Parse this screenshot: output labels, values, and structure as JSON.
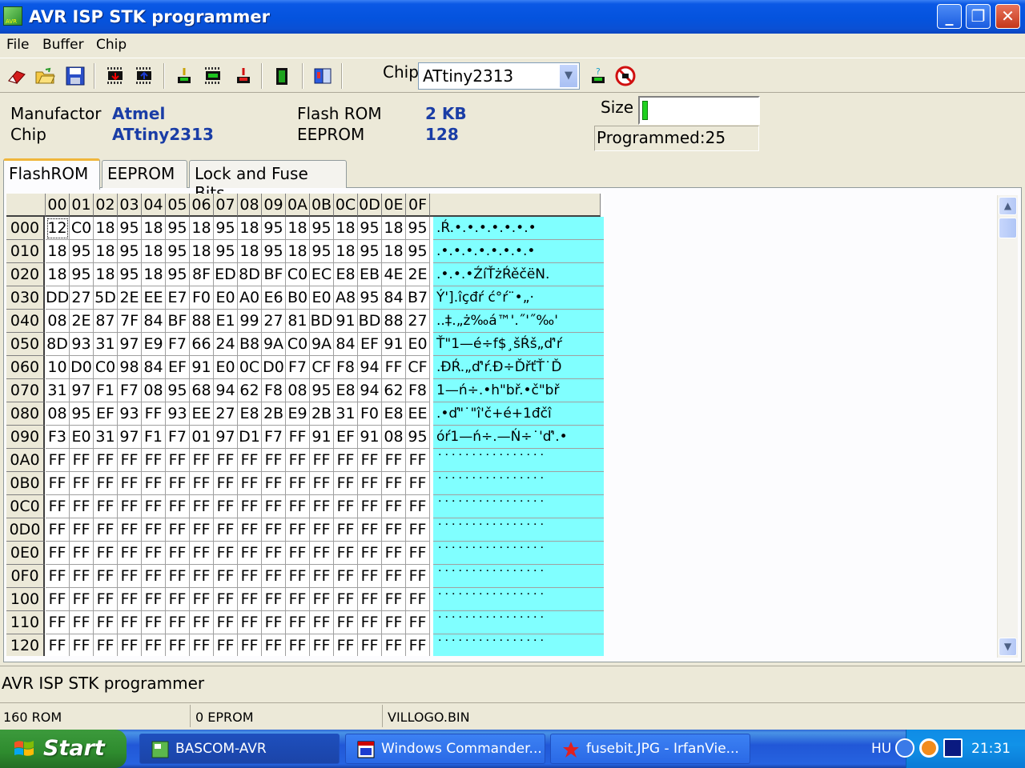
{
  "window": {
    "title": "AVR ISP STK programmer",
    "minimize_glyph": "_",
    "maximize_glyph": "❐",
    "close_glyph": "✕"
  },
  "menu": [
    "File",
    "Buffer",
    "Chip"
  ],
  "toolbar": {
    "icons": [
      "eraser-icon",
      "open-folder-icon",
      "save-icon",
      "chip-read-icon",
      "chip-write-icon",
      "chip-verify-icon",
      "chip-program-icon",
      "chip-erase-icon",
      "chip-lock-icon",
      "chip-info-icon"
    ],
    "chip_label": "Chip",
    "chip_value": "ATtiny2313"
  },
  "info": {
    "manufactor_label": "Manufactor",
    "manufactor_value": "Atmel",
    "chip_label": "Chip",
    "chip_value": "ATtiny2313",
    "flash_label": "Flash ROM",
    "flash_value": "2 KB",
    "eeprom_label": "EEPROM",
    "eeprom_value": "128",
    "size_label": "Size",
    "size_fraction": 0.05,
    "programmed": "Programmed:25"
  },
  "tabs": [
    "FlashROM",
    "EEPROM",
    "Lock and Fuse Bits"
  ],
  "grid": {
    "columns": [
      "00",
      "01",
      "02",
      "03",
      "04",
      "05",
      "06",
      "07",
      "08",
      "09",
      "0A",
      "0B",
      "0C",
      "0D",
      "0E",
      "0F"
    ],
    "rows": [
      {
        "addr": "000",
        "cells": [
          "12",
          "C0",
          "18",
          "95",
          "18",
          "95",
          "18",
          "95",
          "18",
          "95",
          "18",
          "95",
          "18",
          "95",
          "18",
          "95"
        ],
        "ascii": ".Ŕ.•.•.•.•.•.•.•"
      },
      {
        "addr": "010",
        "cells": [
          "18",
          "95",
          "18",
          "95",
          "18",
          "95",
          "18",
          "95",
          "18",
          "95",
          "18",
          "95",
          "18",
          "95",
          "18",
          "95"
        ],
        "ascii": ".•.•.•.•.•.•.•.•"
      },
      {
        "addr": "020",
        "cells": [
          "18",
          "95",
          "18",
          "95",
          "18",
          "95",
          "8F",
          "ED",
          "8D",
          "BF",
          "C0",
          "EC",
          "E8",
          "EB",
          "4E",
          "2E"
        ],
        "ascii": ".•.•.•ŹíŤżŔěčëN."
      },
      {
        "addr": "030",
        "cells": [
          "DD",
          "27",
          "5D",
          "2E",
          "EE",
          "E7",
          "F0",
          "E0",
          "A0",
          "E6",
          "B0",
          "E0",
          "A8",
          "95",
          "84",
          "B7"
        ],
        "ascii": "Ý'].îçđŕ ć°ŕ¨•„·"
      },
      {
        "addr": "040",
        "cells": [
          "08",
          "2E",
          "87",
          "7F",
          "84",
          "BF",
          "88",
          "E1",
          "99",
          "27",
          "81",
          "BD",
          "91",
          "BD",
          "88",
          "27"
        ],
        "ascii": "..‡.„ż‰á™'.˝'˝‰'"
      },
      {
        "addr": "050",
        "cells": [
          "8D",
          "93",
          "31",
          "97",
          "E9",
          "F7",
          "66",
          "24",
          "B8",
          "9A",
          "C0",
          "9A",
          "84",
          "EF",
          "91",
          "E0"
        ],
        "ascii": "Ť\"1—é÷f$¸šŔš„ď'ŕ"
      },
      {
        "addr": "060",
        "cells": [
          "10",
          "D0",
          "C0",
          "98",
          "84",
          "EF",
          "91",
          "E0",
          "0C",
          "D0",
          "F7",
          "CF",
          "F8",
          "94",
          "FF",
          "CF"
        ],
        "ascii": ".ĐŔ.„ď'ŕ.Đ÷ĎřťŤ˙Ď"
      },
      {
        "addr": "070",
        "cells": [
          "31",
          "97",
          "F1",
          "F7",
          "08",
          "95",
          "68",
          "94",
          "62",
          "F8",
          "08",
          "95",
          "E8",
          "94",
          "62",
          "F8"
        ],
        "ascii": "1—ń÷.•h\"bř.•č\"bř"
      },
      {
        "addr": "080",
        "cells": [
          "08",
          "95",
          "EF",
          "93",
          "FF",
          "93",
          "EE",
          "27",
          "E8",
          "2B",
          "E9",
          "2B",
          "31",
          "F0",
          "E8",
          "EE"
        ],
        "ascii": ".•ď\"˙\"î'č+é+1đčî"
      },
      {
        "addr": "090",
        "cells": [
          "F3",
          "E0",
          "31",
          "97",
          "F1",
          "F7",
          "01",
          "97",
          "D1",
          "F7",
          "FF",
          "91",
          "EF",
          "91",
          "08",
          "95"
        ],
        "ascii": "óŕ1—ń÷.—Ń÷˙'ď'.•"
      },
      {
        "addr": "0A0",
        "cells": [
          "FF",
          "FF",
          "FF",
          "FF",
          "FF",
          "FF",
          "FF",
          "FF",
          "FF",
          "FF",
          "FF",
          "FF",
          "FF",
          "FF",
          "FF",
          "FF"
        ],
        "ascii": "˙˙˙˙˙˙˙˙˙˙˙˙˙˙˙˙"
      },
      {
        "addr": "0B0",
        "cells": [
          "FF",
          "FF",
          "FF",
          "FF",
          "FF",
          "FF",
          "FF",
          "FF",
          "FF",
          "FF",
          "FF",
          "FF",
          "FF",
          "FF",
          "FF",
          "FF"
        ],
        "ascii": "˙˙˙˙˙˙˙˙˙˙˙˙˙˙˙˙"
      },
      {
        "addr": "0C0",
        "cells": [
          "FF",
          "FF",
          "FF",
          "FF",
          "FF",
          "FF",
          "FF",
          "FF",
          "FF",
          "FF",
          "FF",
          "FF",
          "FF",
          "FF",
          "FF",
          "FF"
        ],
        "ascii": "˙˙˙˙˙˙˙˙˙˙˙˙˙˙˙˙"
      },
      {
        "addr": "0D0",
        "cells": [
          "FF",
          "FF",
          "FF",
          "FF",
          "FF",
          "FF",
          "FF",
          "FF",
          "FF",
          "FF",
          "FF",
          "FF",
          "FF",
          "FF",
          "FF",
          "FF"
        ],
        "ascii": "˙˙˙˙˙˙˙˙˙˙˙˙˙˙˙˙"
      },
      {
        "addr": "0E0",
        "cells": [
          "FF",
          "FF",
          "FF",
          "FF",
          "FF",
          "FF",
          "FF",
          "FF",
          "FF",
          "FF",
          "FF",
          "FF",
          "FF",
          "FF",
          "FF",
          "FF"
        ],
        "ascii": "˙˙˙˙˙˙˙˙˙˙˙˙˙˙˙˙"
      },
      {
        "addr": "0F0",
        "cells": [
          "FF",
          "FF",
          "FF",
          "FF",
          "FF",
          "FF",
          "FF",
          "FF",
          "FF",
          "FF",
          "FF",
          "FF",
          "FF",
          "FF",
          "FF",
          "FF"
        ],
        "ascii": "˙˙˙˙˙˙˙˙˙˙˙˙˙˙˙˙"
      },
      {
        "addr": "100",
        "cells": [
          "FF",
          "FF",
          "FF",
          "FF",
          "FF",
          "FF",
          "FF",
          "FF",
          "FF",
          "FF",
          "FF",
          "FF",
          "FF",
          "FF",
          "FF",
          "FF"
        ],
        "ascii": "˙˙˙˙˙˙˙˙˙˙˙˙˙˙˙˙"
      },
      {
        "addr": "110",
        "cells": [
          "FF",
          "FF",
          "FF",
          "FF",
          "FF",
          "FF",
          "FF",
          "FF",
          "FF",
          "FF",
          "FF",
          "FF",
          "FF",
          "FF",
          "FF",
          "FF"
        ],
        "ascii": "˙˙˙˙˙˙˙˙˙˙˙˙˙˙˙˙"
      },
      {
        "addr": "120",
        "cells": [
          "FF",
          "FF",
          "FF",
          "FF",
          "FF",
          "FF",
          "FF",
          "FF",
          "FF",
          "FF",
          "FF",
          "FF",
          "FF",
          "FF",
          "FF",
          "FF"
        ],
        "ascii": "˙˙˙˙˙˙˙˙˙˙˙˙˙˙˙˙"
      }
    ]
  },
  "status": {
    "message": "AVR ISP STK programmer",
    "panels": [
      "160 ROM",
      "0 EPROM",
      "VILLOGO.BIN"
    ]
  },
  "taskbar": {
    "start": "Start",
    "tasks": [
      "BASCOM-AVR",
      "Windows Commander...",
      "fusebit.JPG - IrfanVie..."
    ],
    "lang": "HU",
    "clock": "21:31"
  },
  "colors": {
    "ascii_bg": "#80ffff",
    "value_text": "#1a3da6",
    "size_fill": "#1fd11f"
  }
}
